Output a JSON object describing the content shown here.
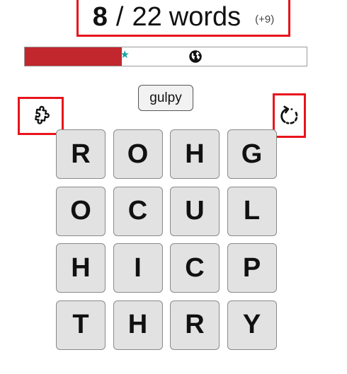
{
  "score": {
    "found": "8",
    "separator": "/",
    "total": "22",
    "unit": "words",
    "bonus": "(+9)"
  },
  "progress": {
    "fraction": 0.345,
    "star_at": 0.355,
    "globe_at": 0.605,
    "fill_color": "#c1272d",
    "star_color": "#1aa3a3",
    "star_icon": "star-icon",
    "globe_icon": "globe-icon"
  },
  "current_word": "gulpy",
  "buttons": {
    "hint_icon": "puzzle-icon",
    "rotate_icon": "rotate-icon",
    "highlight_color": "#e8141c"
  },
  "grid": [
    [
      "R",
      "O",
      "H",
      "G"
    ],
    [
      "O",
      "C",
      "U",
      "L"
    ],
    [
      "H",
      "I",
      "C",
      "P"
    ],
    [
      "T",
      "H",
      "R",
      "Y"
    ]
  ]
}
